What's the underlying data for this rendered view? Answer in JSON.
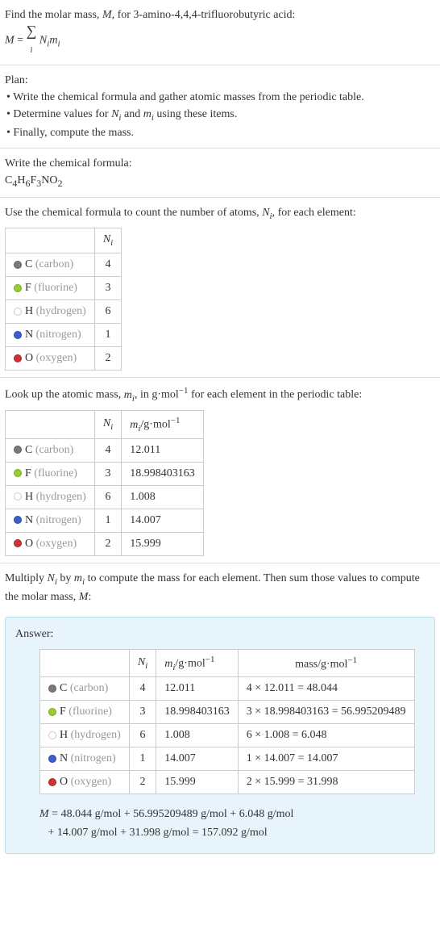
{
  "intro": {
    "line1": "Find the molar mass, ",
    "line1_var": "M",
    "line1_rest": ", for 3-amino-4,4,4-trifluorobutyric acid:",
    "eq_lhs": "M",
    "eq_eq": " = ",
    "sum_i": "i",
    "eq_rhs_N": "N",
    "eq_rhs_m": "m"
  },
  "plan": {
    "heading": "Plan:",
    "b1": "• Write the chemical formula and gather atomic masses from the periodic table.",
    "b2_a": "• Determine values for ",
    "b2_b": " and ",
    "b2_c": " using these items.",
    "b3": "• Finally, compute the mass."
  },
  "chem": {
    "heading": "Write the chemical formula:",
    "formula_parts": [
      "C",
      "4",
      "H",
      "6",
      "F",
      "3",
      "NO",
      "2"
    ]
  },
  "count": {
    "heading_a": "Use the chemical formula to count the number of atoms, ",
    "heading_b": ", for each element:",
    "col_N": "N",
    "col_N_sub": "i"
  },
  "elements": [
    {
      "sym": "C",
      "name": "(carbon)",
      "color": "#7a7a7a",
      "N": "4",
      "m": "12.011",
      "mass": "4 × 12.011 = 48.044"
    },
    {
      "sym": "F",
      "name": "(fluorine)",
      "color": "#9acd32",
      "N": "3",
      "m": "18.998403163",
      "mass": "3 × 18.998403163 = 56.995209489"
    },
    {
      "sym": "H",
      "name": "(hydrogen)",
      "color": "#ffffff",
      "N": "6",
      "m": "1.008",
      "mass": "6 × 1.008 = 6.048"
    },
    {
      "sym": "N",
      "name": "(nitrogen)",
      "color": "#3b5fcd",
      "N": "1",
      "m": "14.007",
      "mass": "1 × 14.007 = 14.007"
    },
    {
      "sym": "O",
      "name": "(oxygen)",
      "color": "#cc3333",
      "N": "2",
      "m": "15.999",
      "mass": "2 × 15.999 = 31.998"
    }
  ],
  "lookup": {
    "heading_a": "Look up the atomic mass, ",
    "heading_b": ", in g·mol",
    "heading_c": " for each element in the periodic table:",
    "col_m": "m",
    "col_m_sub": "i",
    "unit_sup": "−1",
    "unit": "/g·mol"
  },
  "multiply": {
    "line_a": "Multiply ",
    "line_b": " by ",
    "line_c": " to compute the mass for each element. Then sum those values to compute the molar mass, ",
    "line_d": ":"
  },
  "answer": {
    "label": "Answer:",
    "col_mass": "mass/g·mol",
    "final_a": "M",
    "final_b": " = 48.044 g/mol + 56.995209489 g/mol + 6.048 g/mol",
    "final_c": "+ 14.007 g/mol + 31.998 g/mol = 157.092 g/mol"
  }
}
